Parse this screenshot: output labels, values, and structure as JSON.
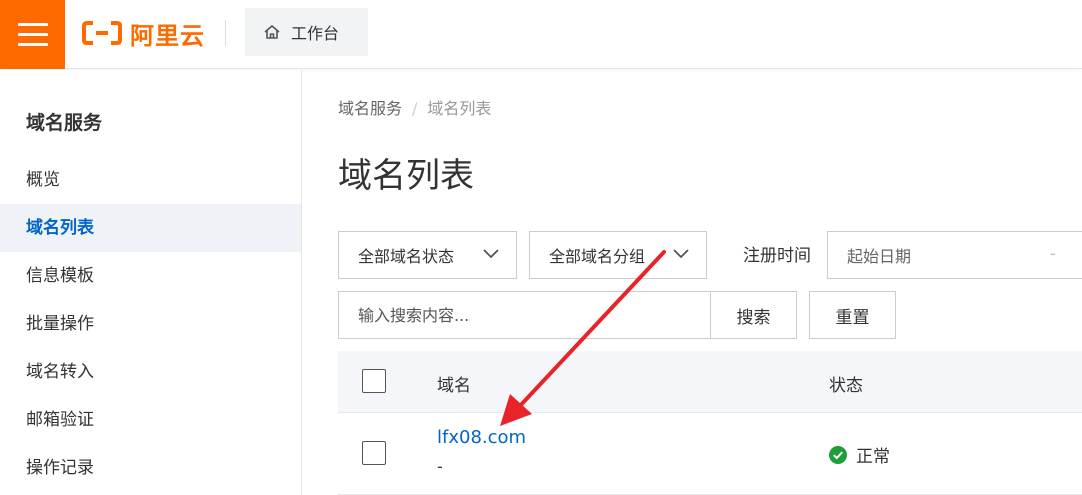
{
  "header": {
    "brand_name": "阿里云",
    "workbench_label": "工作台",
    "colors": {
      "brand": "#ff6a00",
      "link": "#0064c8"
    }
  },
  "sidebar": {
    "title": "域名服务",
    "items": [
      {
        "label": "概览",
        "active": false
      },
      {
        "label": "域名列表",
        "active": true
      },
      {
        "label": "信息模板",
        "active": false
      },
      {
        "label": "批量操作",
        "active": false
      },
      {
        "label": "域名转入",
        "active": false
      },
      {
        "label": "邮箱验证",
        "active": false
      },
      {
        "label": "操作记录",
        "active": false
      }
    ]
  },
  "main": {
    "breadcrumb": {
      "parent": "域名服务",
      "separator": "/",
      "current": "域名列表"
    },
    "title": "域名列表",
    "filters": {
      "status_select": "全部域名状态",
      "group_select": "全部域名分组",
      "reg_time_label": "注册时间",
      "start_date_placeholder": "起始日期",
      "date_separator": "-"
    },
    "search": {
      "placeholder": "输入搜索内容...",
      "search_button": "搜索",
      "reset_button": "重置"
    },
    "table": {
      "columns": [
        "域名",
        "状态"
      ],
      "rows": [
        {
          "domain": "lfx08.com",
          "sub": "-",
          "status": "正常"
        }
      ]
    }
  }
}
